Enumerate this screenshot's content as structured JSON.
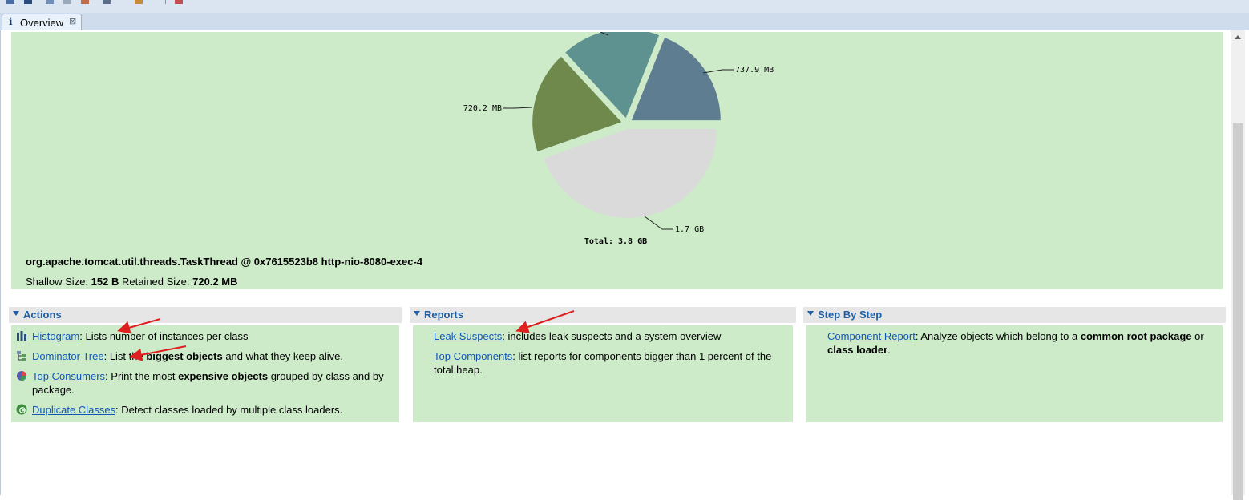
{
  "tab": {
    "label": "Overview"
  },
  "chart_data": {
    "type": "pie",
    "slices": [
      {
        "label": "737.9 MB",
        "value": 737.9,
        "color": "#5f7d91"
      },
      {
        "label": "",
        "value": 700,
        "color": "#5e9290"
      },
      {
        "label": "720.2 MB",
        "value": 720.2,
        "color": "#6e894b"
      },
      {
        "label": "1.7 GB",
        "value": 1740,
        "color": "#dadada"
      }
    ],
    "top_label": "—",
    "total": "Total: 3.8 GB"
  },
  "object": {
    "thread": "org.apache.tomcat.util.threads.TaskThread @ 0x7615523b8 http-nio-8080-exec-4",
    "shallow_label": "Shallow Size: ",
    "shallow_value": "152 B",
    "retained_label": " Retained Size: ",
    "retained_value": "720.2 MB"
  },
  "sections": {
    "actions": {
      "title": "Actions",
      "items": [
        {
          "link": "Histogram",
          "pre": ": Lists number of instances per class"
        },
        {
          "link": "Dominator Tree",
          "pre": ": List the ",
          "bold": "biggest objects",
          "post": " and what they keep alive."
        },
        {
          "link": "Top Consumers",
          "pre": ": Print the most ",
          "bold": "expensive objects",
          "post": " grouped by class and by package."
        },
        {
          "link": "Duplicate Classes",
          "pre": ": Detect classes loaded by multiple class loaders."
        }
      ]
    },
    "reports": {
      "title": "Reports",
      "items": [
        {
          "link": "Leak Suspects",
          "pre": ": includes leak suspects and a system overview"
        },
        {
          "link": "Top Components",
          "pre": ": list reports for components bigger than 1 percent of the total heap."
        }
      ]
    },
    "stepbystep": {
      "title": "Step By Step",
      "items": [
        {
          "link": "Component Report",
          "pre": ": Analyze objects which belong to a ",
          "bold": "common root package",
          "post": " or ",
          "bold2": "class loader",
          "post2": "."
        }
      ]
    }
  },
  "colors": {
    "panel_bg": "#cdebc9",
    "link": "#1255b8",
    "section_title": "#1f5fa6",
    "arrow": "#e02020"
  }
}
